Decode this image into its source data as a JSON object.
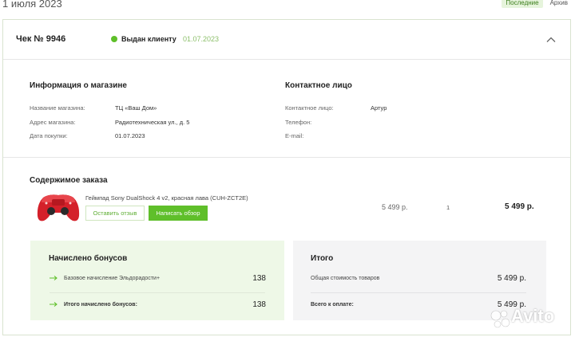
{
  "header": {
    "date_title": "1 июля 2023",
    "tabs": [
      {
        "label": "Последние",
        "active": true
      },
      {
        "label": "Архив",
        "active": false
      }
    ]
  },
  "receipt": {
    "number": "Чек № 9946",
    "status": "Выдан клиенту",
    "status_date": "01.07.2023",
    "status_color": "#5fbf2a"
  },
  "store_info": {
    "title": "Информация о магазине",
    "rows": [
      {
        "label": "Название магазина:",
        "value": "ТЦ «Ваш Дом»"
      },
      {
        "label": "Адрес магазина:",
        "value": "Радиотехническая ул., д. 5"
      },
      {
        "label": "Дата покупки:",
        "value": "01.07.2023"
      }
    ]
  },
  "contact_info": {
    "title": "Контактное лицо",
    "rows": [
      {
        "label": "Контактное лицо:",
        "value": "Артур"
      },
      {
        "label": "Телефон:",
        "value": ""
      },
      {
        "label": "E-mail:",
        "value": ""
      }
    ]
  },
  "order": {
    "title": "Содержимое заказа",
    "items": [
      {
        "name": "Геймпад Sony DualShock 4 v2, красная лава (CUH-ZCT2E)",
        "review_button": "Оставить отзыв",
        "write_review_button": "Написать обзор",
        "price": "5 499 р.",
        "quantity": "1",
        "total": "5 499 р."
      }
    ]
  },
  "bonus": {
    "title": "Начислено бонусов",
    "rows": [
      {
        "label": "Базовое начисление Эльдорадости+",
        "value": "138"
      },
      {
        "label": "Итого начислено бонусов:",
        "value": "138"
      }
    ]
  },
  "totals": {
    "title": "Итого",
    "rows": [
      {
        "label": "Общая стоимость товаров",
        "value": "5 499 р."
      },
      {
        "label": "Всего к оплате:",
        "value": "5 499 р."
      }
    ]
  },
  "watermark": {
    "text": "Avito"
  },
  "colors": {
    "accent": "#5fbf2a",
    "bonus_bg": "#eef8e7",
    "totals_bg": "#f4f4f5"
  }
}
